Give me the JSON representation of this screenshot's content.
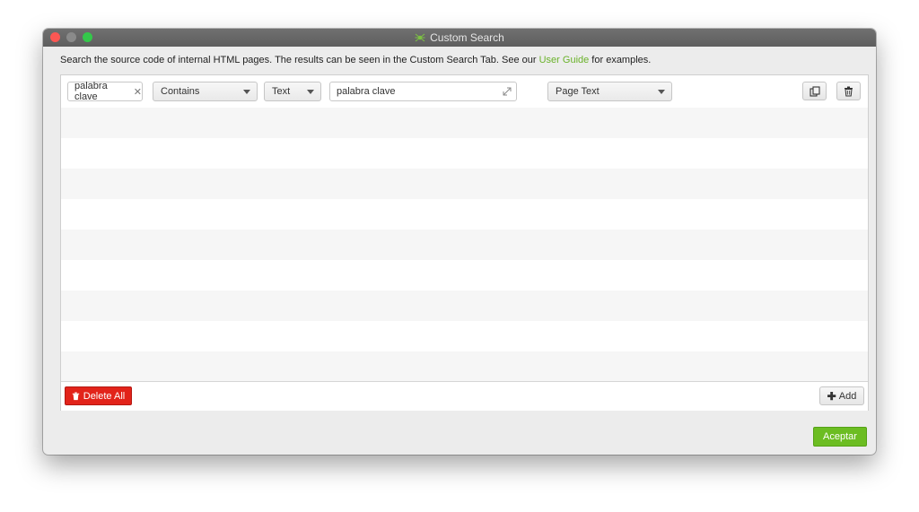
{
  "window": {
    "title": "Custom Search",
    "icon": "spider-icon"
  },
  "description": {
    "text_before": "Search the source code of internal HTML pages. The results can be seen in the Custom Search Tab. See our ",
    "link_text": "User Guide",
    "text_after": " for examples."
  },
  "filter_row": {
    "chip_label": "palabra clave",
    "chip_close_icon": "close-icon",
    "operator_select": "Contains",
    "type_select": "Text",
    "search_value": "palabra clave",
    "expand_icon": "expand-icon",
    "target_select": "Page Text",
    "duplicate_icon": "duplicate-icon",
    "delete_icon": "trash-icon"
  },
  "footer": {
    "delete_all_label": "Delete All",
    "add_label": "Add"
  },
  "actions": {
    "accept_label": "Aceptar"
  },
  "colors": {
    "link": "#6ab22a",
    "delete_all": "#e2231a",
    "accept": "#6cbd22",
    "traffic_close": "#fc5753",
    "traffic_zoom": "#34c84a"
  }
}
